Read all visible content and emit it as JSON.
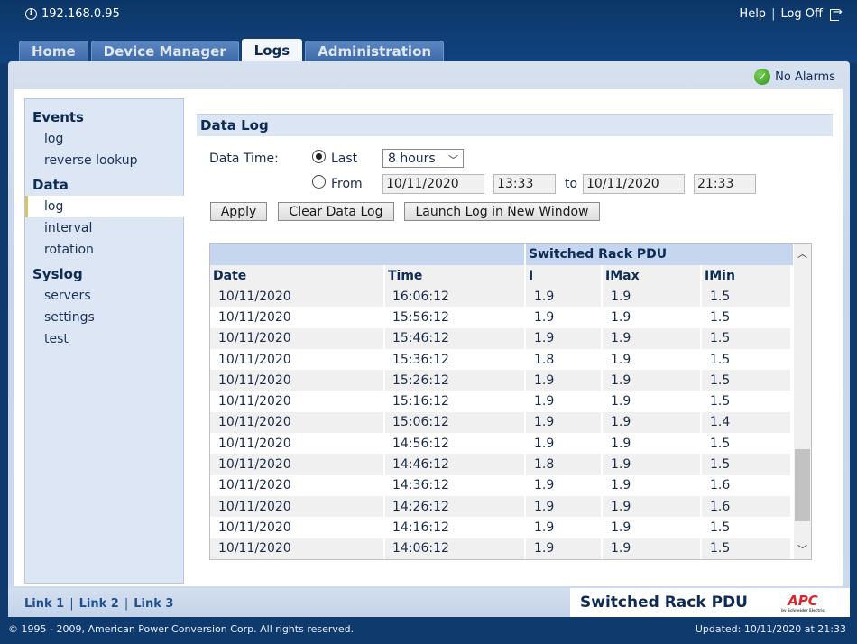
{
  "header": {
    "ip": "192.168.0.95",
    "help_label": "Help",
    "separator": "|",
    "logoff_label": "Log Off"
  },
  "tabs": [
    {
      "label": "Home"
    },
    {
      "label": "Device Manager"
    },
    {
      "label": "Logs"
    },
    {
      "label": "Administration"
    }
  ],
  "status": {
    "alarm_text": "No Alarms"
  },
  "sidebar": {
    "sections": [
      {
        "title": "Events",
        "items": [
          "log",
          "reverse lookup"
        ]
      },
      {
        "title": "Data",
        "items": [
          "log",
          "interval",
          "rotation"
        ]
      },
      {
        "title": "Syslog",
        "items": [
          "servers",
          "settings",
          "test"
        ]
      }
    ]
  },
  "datalog": {
    "title": "Data Log",
    "data_time_label": "Data Time:",
    "last_label": "Last",
    "last_value": "8 hours",
    "from_label": "From",
    "from_date": "10/11/2020",
    "from_time": "13:33",
    "to_label": "to",
    "to_date": "10/11/2020",
    "to_time": "21:33",
    "apply_label": "Apply",
    "clear_label": "Clear Data Log",
    "launch_label": "Launch Log in New Window"
  },
  "table": {
    "group_header": "Switched Rack PDU",
    "headers": {
      "date": "Date",
      "time": "Time",
      "i": "I",
      "imax": "IMax",
      "imin": "IMin"
    },
    "rows": [
      {
        "date": "10/11/2020",
        "time": "16:06:12",
        "i": "1.9",
        "imax": "1.9",
        "imin": "1.5"
      },
      {
        "date": "10/11/2020",
        "time": "15:56:12",
        "i": "1.9",
        "imax": "1.9",
        "imin": "1.5"
      },
      {
        "date": "10/11/2020",
        "time": "15:46:12",
        "i": "1.9",
        "imax": "1.9",
        "imin": "1.5"
      },
      {
        "date": "10/11/2020",
        "time": "15:36:12",
        "i": "1.8",
        "imax": "1.9",
        "imin": "1.5"
      },
      {
        "date": "10/11/2020",
        "time": "15:26:12",
        "i": "1.9",
        "imax": "1.9",
        "imin": "1.5"
      },
      {
        "date": "10/11/2020",
        "time": "15:16:12",
        "i": "1.9",
        "imax": "1.9",
        "imin": "1.5"
      },
      {
        "date": "10/11/2020",
        "time": "15:06:12",
        "i": "1.9",
        "imax": "1.9",
        "imin": "1.4"
      },
      {
        "date": "10/11/2020",
        "time": "14:56:12",
        "i": "1.9",
        "imax": "1.9",
        "imin": "1.5"
      },
      {
        "date": "10/11/2020",
        "time": "14:46:12",
        "i": "1.8",
        "imax": "1.9",
        "imin": "1.5"
      },
      {
        "date": "10/11/2020",
        "time": "14:36:12",
        "i": "1.9",
        "imax": "1.9",
        "imin": "1.6"
      },
      {
        "date": "10/11/2020",
        "time": "14:26:12",
        "i": "1.9",
        "imax": "1.9",
        "imin": "1.6"
      },
      {
        "date": "10/11/2020",
        "time": "14:16:12",
        "i": "1.9",
        "imax": "1.9",
        "imin": "1.5"
      },
      {
        "date": "10/11/2020",
        "time": "14:06:12",
        "i": "1.9",
        "imax": "1.9",
        "imin": "1.5"
      }
    ]
  },
  "footer": {
    "links": [
      "Link 1",
      "Link 2",
      "Link 3"
    ],
    "product_name": "Switched Rack PDU",
    "logo_text": "APC",
    "logo_subtext": "by Schneider Electric",
    "copyright": "© 1995 - 2009, American Power Conversion Corp. All rights reserved.",
    "updated": "Updated: 10/11/2020 at 21:33"
  },
  "colors": {
    "accent": "#0d2b55",
    "header_bg": "#0c3667",
    "panel_bg": "#d6e0ef",
    "alarm_ok": "#2f8f1c",
    "logo_red": "#d7262c"
  }
}
